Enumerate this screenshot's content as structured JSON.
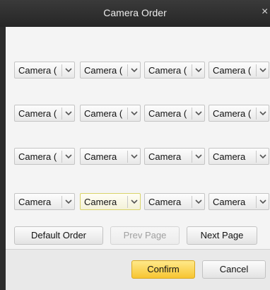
{
  "window": {
    "title": "Camera Order",
    "close_label": "×"
  },
  "cameras": {
    "rows": [
      [
        "Camera (",
        "Camera (",
        "Camera (",
        "Camera ("
      ],
      [
        "Camera (",
        "Camera (",
        "Camera (",
        "Camera ("
      ],
      [
        "Camera (",
        "Camera ",
        "Camera ",
        "Camera "
      ],
      [
        "Camera ",
        "Camera ",
        "Camera ",
        "Camera "
      ]
    ],
    "focused": [
      3,
      1
    ]
  },
  "buttons": {
    "default_order": "Default Order",
    "prev_page": "Prev Page",
    "next_page": "Next Page",
    "confirm": "Confirm",
    "cancel": "Cancel"
  },
  "colors": {
    "titlebar": "#2f2f2f",
    "panel": "#f4f4f4",
    "confirm_accent": "#f7c531"
  }
}
